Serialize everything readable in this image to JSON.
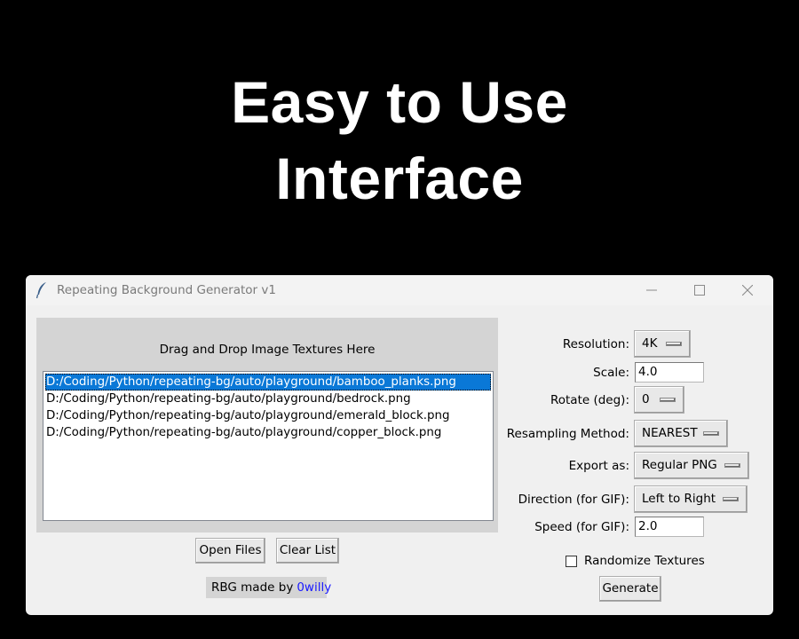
{
  "headline": {
    "line1": "Easy to Use",
    "line2": "Interface"
  },
  "window": {
    "title": "Repeating Background Generator v1",
    "icon": "feather-icon"
  },
  "drop_area": {
    "label": "Drag and Drop Image Textures Here",
    "files": [
      "D:/Coding/Python/repeating-bg/auto/playground/bamboo_planks.png",
      "D:/Coding/Python/repeating-bg/auto/playground/bedrock.png",
      "D:/Coding/Python/repeating-bg/auto/playground/emerald_block.png",
      "D:/Coding/Python/repeating-bg/auto/playground/copper_block.png"
    ],
    "selected_index": 0
  },
  "buttons": {
    "open_files": "Open Files",
    "clear_list": "Clear List",
    "generate": "Generate"
  },
  "credit": {
    "prefix": "RBG made by",
    "author": "0willy",
    "author_color": "#1a1aff"
  },
  "settings": {
    "resolution": {
      "label": "Resolution:",
      "value": "4K"
    },
    "scale": {
      "label": "Scale:",
      "value": "4.0"
    },
    "rotate": {
      "label": "Rotate (deg):",
      "value": "0"
    },
    "resampling": {
      "label": "Resampling Method:",
      "value": "NEAREST"
    },
    "export": {
      "label": "Export as:",
      "value": "Regular PNG"
    },
    "direction": {
      "label": "Direction (for GIF):",
      "value": "Left to Right"
    },
    "speed": {
      "label": "Speed (for GIF):",
      "value": "2.0"
    },
    "randomize": {
      "label": "Randomize Textures",
      "checked": false
    }
  },
  "colors": {
    "selection": "#0a78d7",
    "background": "#000000",
    "window": "#f0f0f0"
  }
}
